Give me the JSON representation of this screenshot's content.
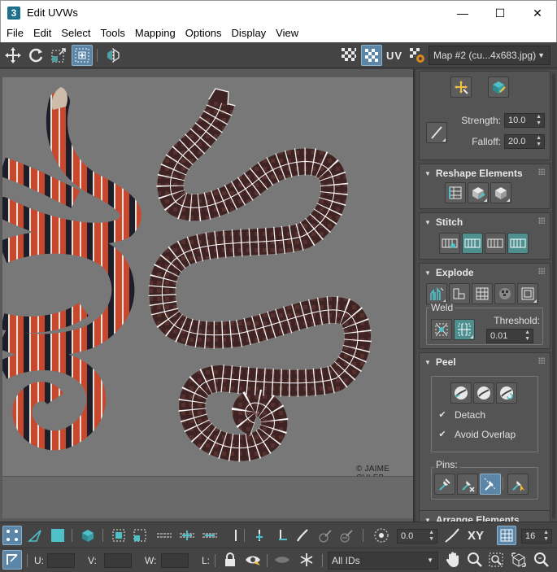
{
  "window": {
    "app_icon": "3",
    "title": "Edit UVWs",
    "minimize": "—",
    "maximize": "☐",
    "close": "✕"
  },
  "menu": [
    "File",
    "Edit",
    "Select",
    "Tools",
    "Mapping",
    "Options",
    "Display",
    "View"
  ],
  "toolbar": {
    "uv_label": "UV",
    "map_selector": "Map #2 (cu...4x683.jpg)"
  },
  "viewport": {
    "watermark": "© JAIME CULEB"
  },
  "panel": {
    "soft": {
      "strength_label": "Strength:",
      "strength_value": "10.0",
      "falloff_label": "Falloff:",
      "falloff_value": "20.0"
    },
    "reshape": {
      "title": "Reshape Elements"
    },
    "stitch": {
      "title": "Stitch"
    },
    "explode": {
      "title": "Explode",
      "weld_label": "Weld",
      "threshold_label": "Threshold:",
      "threshold_value": "0.01"
    },
    "peel": {
      "title": "Peel",
      "detach_label": "Detach",
      "detach_checked": "✔",
      "avoid_overlap_label": "Avoid Overlap",
      "avoid_overlap_checked": "✔",
      "pins_label": "Pins:"
    },
    "arrange": {
      "title": "Arrange Elements"
    }
  },
  "bottom": {
    "rotate_value": "0.0",
    "xy_label": "XY",
    "snap_value": "16",
    "u_label": "U:",
    "v_label": "V:",
    "w_label": "W:",
    "l_label": "L:",
    "ids_combo": "All IDs"
  },
  "colors": {
    "accent_blue": "#5b86a8",
    "teal": "#4e8f8f",
    "panel_bg": "#545454",
    "toolbar_bg": "#444444"
  }
}
